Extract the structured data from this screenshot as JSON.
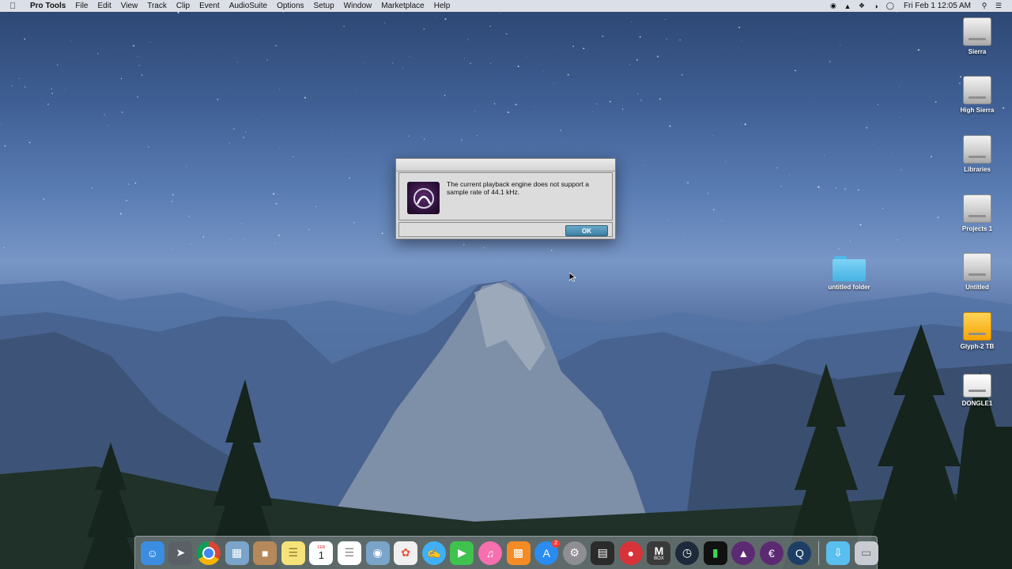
{
  "menubar": {
    "app_name": "Pro Tools",
    "items": [
      "File",
      "Edit",
      "View",
      "Track",
      "Clip",
      "Event",
      "AudioSuite",
      "Options",
      "Setup",
      "Window",
      "Marketplace",
      "Help"
    ],
    "clock": "Fri Feb 1  12:05 AM"
  },
  "dialog": {
    "message": "The current playback engine does not support a sample rate of 44.1 kHz.",
    "ok_label": "OK"
  },
  "desktop": {
    "icons": [
      {
        "label": "Sierra",
        "kind": "drive"
      },
      {
        "label": "High Sierra",
        "kind": "drive"
      },
      {
        "label": "Libraries",
        "kind": "drive"
      },
      {
        "label": "Projects 1",
        "kind": "drive"
      },
      {
        "label": "Untitled",
        "kind": "drive"
      },
      {
        "label": "Glyph-2 TB",
        "kind": "drive-orange"
      },
      {
        "label": "DONGLE1",
        "kind": "drive-white"
      }
    ],
    "folder_label": "untitled folder"
  },
  "dock": {
    "calendar_month": "FEB",
    "calendar_day": "1",
    "appstore_badge": "2",
    "mbox_label": "M",
    "mbox_sub": "BOX",
    "colors": {
      "finder": "#3a8de0",
      "launchpad": "#5b5f66",
      "chrome": "#e8e8e8",
      "preview": "#7aa4c9",
      "contacts": "#b5895a",
      "notes": "#f7e27a",
      "calendar": "#ffffff",
      "reminders": "#ffffff",
      "photos": "#f0f0f0",
      "messages": "#3fb0f5",
      "facetime": "#3fc24e",
      "itunes": "#f76fae",
      "ibooks": "#f58b25",
      "appstore": "#2a8cf0",
      "sysprefs": "#8e8e93",
      "midi": "#2b2b2b",
      "lips": "#d8323a",
      "mbox": "#3a3a3a",
      "protools": "#5c2a72",
      "folder": "#59bfee",
      "trash": "#c8ccd2"
    }
  }
}
